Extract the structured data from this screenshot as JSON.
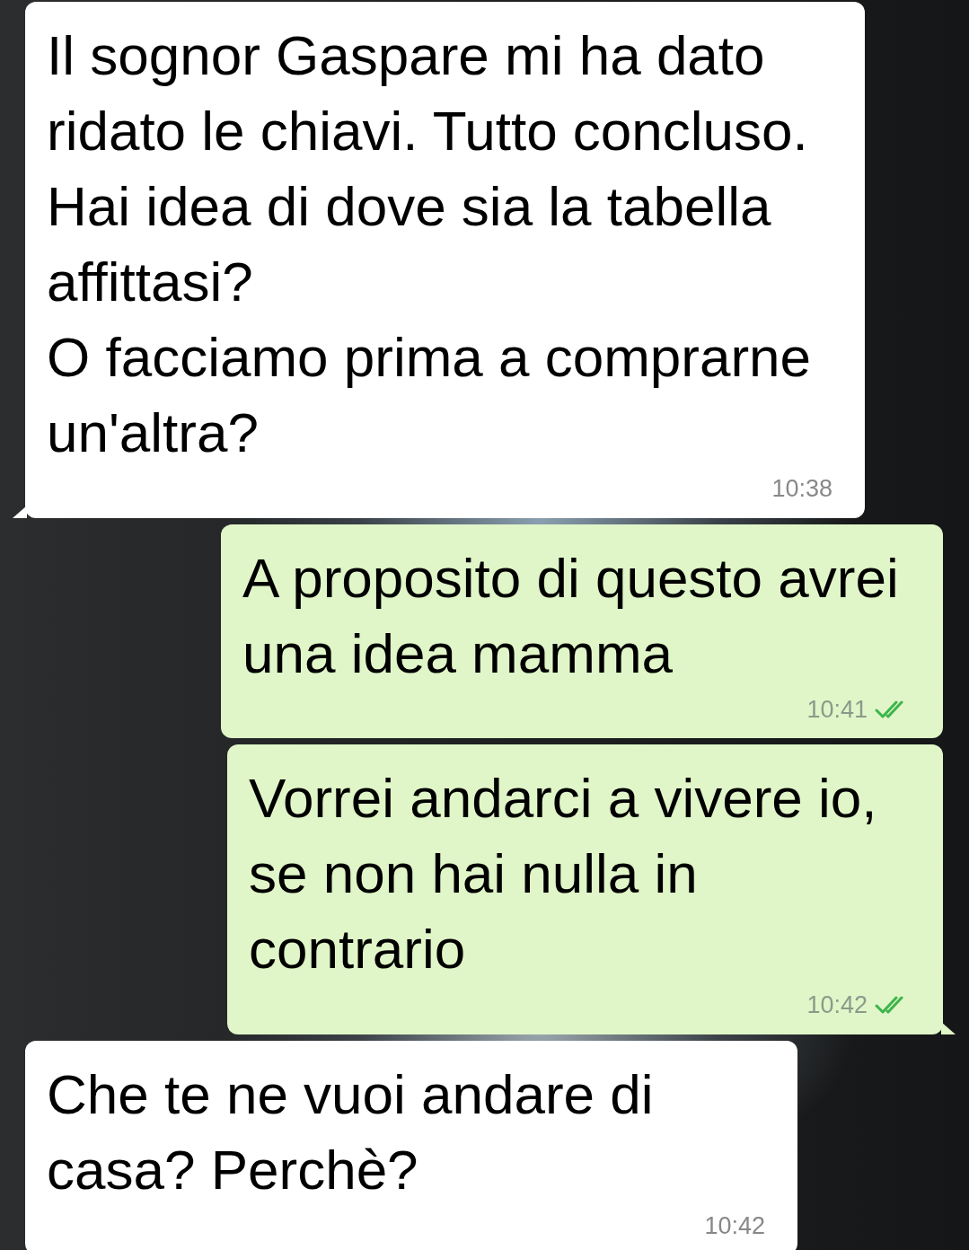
{
  "messages": [
    {
      "kind": "incoming",
      "text": "Il sognor Gaspare mi ha dato ridato le chiavi. Tutto concluso. Hai idea di dove sia la tabella affittasi?\nO facciamo prima a comprarne un'altra?",
      "time": "10:38",
      "tail": true
    },
    {
      "kind": "outgoing",
      "text": "A proposito di questo avrei una idea mamma",
      "time": "10:41",
      "read": true,
      "tail": false
    },
    {
      "kind": "outgoing",
      "text": "Vorrei andarci a vivere io, se non hai nulla in contrario",
      "time": "10:42",
      "read": true,
      "tail": true
    },
    {
      "kind": "incoming",
      "text": "Che te ne vuoi andare di casa? Perchè?",
      "time": "10:42",
      "tail": false
    }
  ]
}
